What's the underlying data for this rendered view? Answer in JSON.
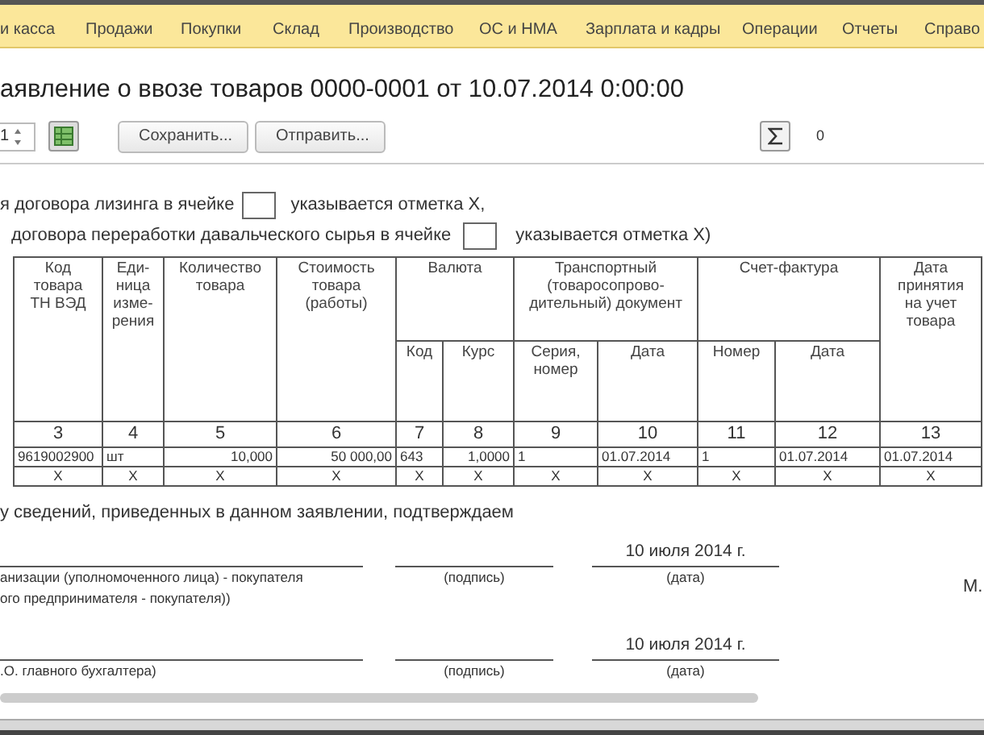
{
  "menu": [
    {
      "label": "и касса"
    },
    {
      "label": "Продажи"
    },
    {
      "label": "Покупки"
    },
    {
      "label": "Склад"
    },
    {
      "label": "Производство"
    },
    {
      "label": "ОС и НМА"
    },
    {
      "label": "Зарплата и кадры"
    },
    {
      "label": "Операции"
    },
    {
      "label": "Отчеты"
    },
    {
      "label": "Справо"
    }
  ],
  "title": "аявление о ввозе товаров 0000-0001 от 10.07.2014 0:00:00",
  "toolbar": {
    "page": "1",
    "buttons": [
      "Сохранить...",
      "Отправить..."
    ],
    "sum": "0"
  },
  "notes": [
    {
      "before": "я договора лизинга в ячейке",
      "after": "указывается отметка X,"
    },
    {
      "before": "договора переработки давальческого сырья в ячейке",
      "after": "указывается отметка X)"
    }
  ],
  "table": {
    "header_rows": [
      [
        {
          "label": "Код товара ТН ВЭД",
          "rowspan": 2
        },
        {
          "label": "Еди-ница изме-рения",
          "rowspan": 2
        },
        {
          "label": "Количество товара",
          "rowspan": 2,
          "numeric": true
        },
        {
          "label": "Стоимость товара (работы)",
          "rowspan": 2,
          "numeric": true
        },
        {
          "label": "Валюта",
          "colspan": 2
        },
        {
          "label": "Транспортный (товаросопрово-дительный) документ",
          "colspan": 2
        },
        {
          "label": "Счет-фактура",
          "colspan": 2
        },
        {
          "label": "Дата принятия на учет товара",
          "rowspan": 2
        }
      ],
      [
        {
          "label": "Код"
        },
        {
          "label": "Курс",
          "numeric": true
        },
        {
          "label": "Серия, номер"
        },
        {
          "label": "Дата"
        },
        {
          "label": "Номер"
        },
        {
          "label": "Дата"
        }
      ]
    ],
    "numbers": [
      "3",
      "4",
      "5",
      "6",
      "7",
      "8",
      "9",
      "10",
      "11",
      "12",
      "13"
    ],
    "rows": [
      {
        "kind": "data",
        "cells": [
          "9619002900",
          "шт",
          "10,000",
          "50 000,00",
          "643",
          "1,0000",
          "1",
          "01.07.2014",
          "1",
          "01.07.2014",
          "01.07.2014"
        ]
      },
      {
        "kind": "marks",
        "cells": [
          "X",
          "X",
          "X",
          "X",
          "X",
          "X",
          "X",
          "X",
          "X",
          "X",
          "X"
        ]
      }
    ]
  },
  "confirm": "у сведений, приведенных в данном заявлении, подтверждаем",
  "signatures": [
    {
      "caption": "анизации (уполномоченного лица) - покупателя\nого предпринимателя - покупателя))",
      "sign_caption": "(подпись)",
      "date": "10 июля 2014 г.",
      "date_caption": "(дата)",
      "stamp": "М."
    },
    {
      "caption": ".О. главного бухгалтера)",
      "sign_caption": "(подпись)",
      "date": "10 июля 2014 г.",
      "date_caption": "(дата)"
    }
  ]
}
